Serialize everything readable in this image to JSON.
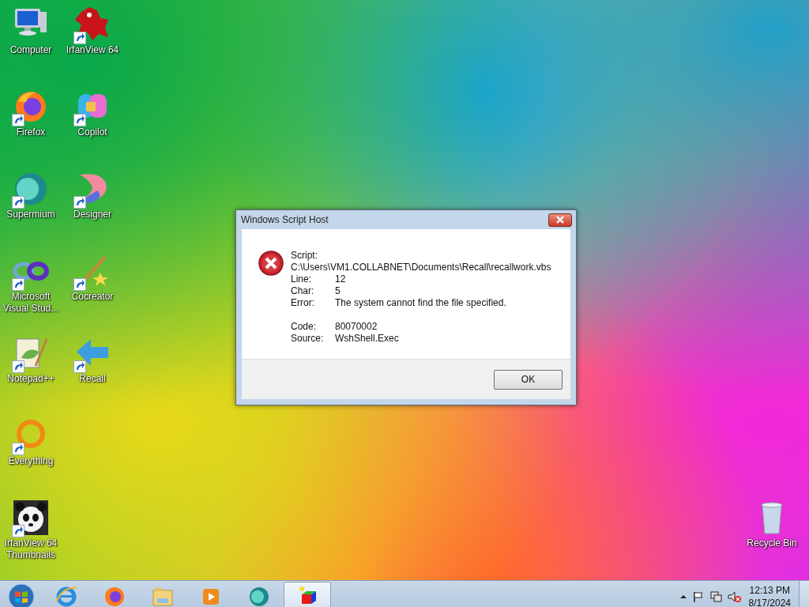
{
  "desktop_rows": [
    [
      {
        "label": "Computer",
        "kind": "computer",
        "shortcut": false
      },
      {
        "label": "IrfanView 64",
        "kind": "irfanview",
        "shortcut": true
      }
    ],
    [
      {
        "label": "Firefox",
        "kind": "firefox",
        "shortcut": true
      },
      {
        "label": "Copilot",
        "kind": "copilot",
        "shortcut": true
      }
    ],
    [
      {
        "label": "Supermium",
        "kind": "supermium",
        "shortcut": true
      },
      {
        "label": "Designer",
        "kind": "designer",
        "shortcut": true
      }
    ],
    [
      {
        "label": "Microsoft Visual Stud...",
        "kind": "infinity",
        "shortcut": true
      },
      {
        "label": "Cocreator",
        "kind": "wand",
        "shortcut": true
      }
    ],
    [
      {
        "label": "Notepad++",
        "kind": "notepad",
        "shortcut": true
      },
      {
        "label": "Recall",
        "kind": "recall",
        "shortcut": true
      }
    ],
    [
      {
        "label": "Everything",
        "kind": "ring",
        "shortcut": true
      }
    ],
    [
      {
        "label": "IrfanView 64 Thumbnails",
        "kind": "panda",
        "shortcut": true
      }
    ]
  ],
  "recycle_bin": {
    "label": "Recycle Bin"
  },
  "dialog": {
    "title": "Windows Script Host",
    "script_label": "Script:",
    "script_path": "C:\\Users\\VM1.COLLABNET\\Documents\\Recall\\recallwork.vbs",
    "groups": [
      [
        {
          "label": "Line:",
          "value": "12"
        },
        {
          "label": "Char:",
          "value": "5"
        },
        {
          "label": "Error:",
          "value": "The system cannot find the file specified."
        }
      ],
      [
        {
          "label": "Code:",
          "value": "80070002"
        },
        {
          "label": "Source:",
          "value": "WshShell.Exec"
        }
      ]
    ],
    "buttons": [
      "OK"
    ]
  },
  "taskbar": {
    "items": [
      {
        "kind": "ie",
        "selected": false
      },
      {
        "kind": "firefox",
        "selected": false
      },
      {
        "kind": "explorer",
        "selected": false
      },
      {
        "kind": "media",
        "selected": false
      },
      {
        "kind": "supermium",
        "selected": false
      },
      {
        "kind": "cube",
        "selected": true
      }
    ],
    "tray": {
      "time": "12:13 PM",
      "date": "8/17/2024"
    }
  }
}
